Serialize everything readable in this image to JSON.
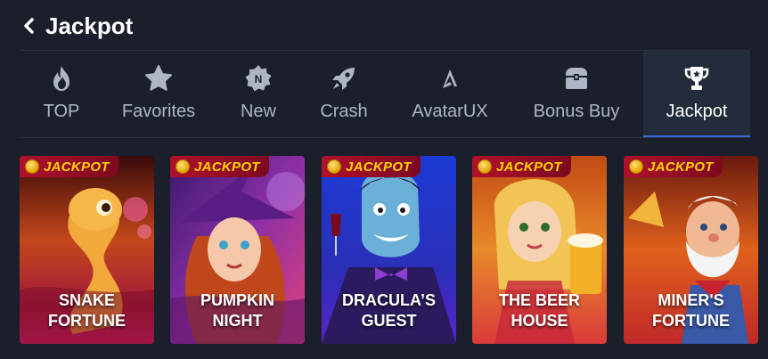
{
  "header": {
    "title": "Jackpot"
  },
  "tabs": [
    {
      "label": "TOP",
      "icon": "flame-icon",
      "active": false
    },
    {
      "label": "Favorites",
      "icon": "star-icon",
      "active": false
    },
    {
      "label": "New",
      "icon": "new-badge-icon",
      "active": false
    },
    {
      "label": "Crash",
      "icon": "rocket-icon",
      "active": false
    },
    {
      "label": "AvatarUX",
      "icon": "avatarux-logo-icon",
      "active": false
    },
    {
      "label": "Bonus Buy",
      "icon": "chest-icon",
      "active": false
    },
    {
      "label": "Jackpot",
      "icon": "trophy-icon",
      "active": true
    }
  ],
  "badge_label": "JACKPOT",
  "games": [
    {
      "title": "SNAKE\nFORTUNE"
    },
    {
      "title": "PUMPKIN\nNIGHT"
    },
    {
      "title": "DRACULA’S\nGUEST"
    },
    {
      "title": "THE BEER\nHOUSE"
    },
    {
      "title": "MINER'S\nFORTUNE"
    }
  ],
  "colors": {
    "background": "#1a1f2b",
    "active_tab": "#232c3b",
    "badge_red": "#b0102a",
    "badge_text": "#ffd400"
  }
}
